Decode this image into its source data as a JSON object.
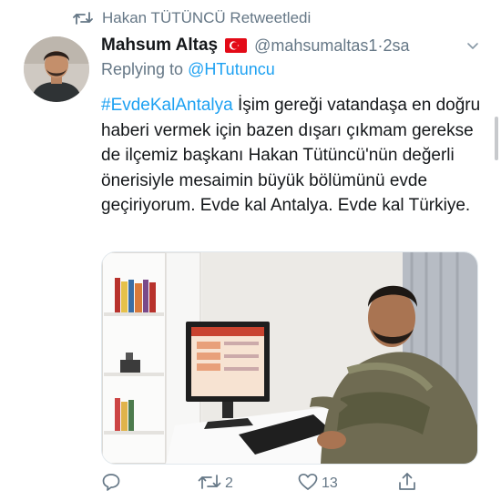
{
  "retweet": {
    "icon": "retweet-icon",
    "text": "Hakan TÜTÜNCÜ Retweetledi"
  },
  "author": {
    "display_name": "Mahsum Altaş",
    "flag": "turkey-flag-icon",
    "handle": "@mahsumaltas1",
    "separator": "·",
    "time": "2sa"
  },
  "reply": {
    "prefix": "Replying to",
    "mention": "@HTutuncu"
  },
  "tweet": {
    "hashtag": "#EvdeKalAntalya",
    "body": "İşim gereği vatandaşa en doğru haberi vermek için bazen dışarı çıkmam gerekse de ilçemiz başkanı Hakan Tütüncü'nün değerli önerisiyle mesaimin büyük bölümünü evde geçiriyorum. Evde kal Antalya. Evde kal Türkiye."
  },
  "actions": {
    "reply_icon": "reply-icon",
    "retweet_icon": "retweet-icon",
    "retweet_count": "2",
    "like_icon": "heart-icon",
    "like_count": "13",
    "share_icon": "share-icon"
  },
  "colors": {
    "accent": "#1da1f2",
    "secondary_text": "#657786",
    "primary_text": "#14171a"
  }
}
